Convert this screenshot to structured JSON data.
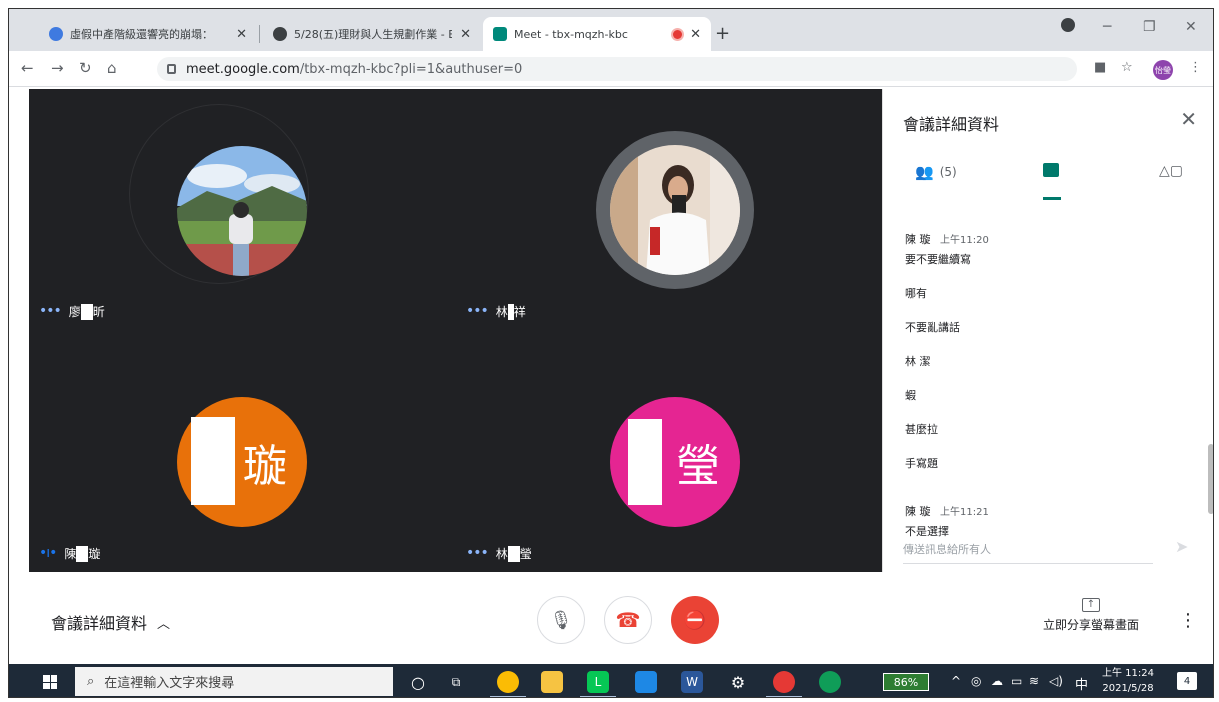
{
  "browser": {
    "tabs": [
      {
        "title": "虛假中產階級還響亮的崩塌：",
        "favicon_color": "#3f7ae0"
      },
      {
        "title": "5/28(五)理財與人生規劃作業 - E",
        "favicon_color": "#3c4043"
      },
      {
        "title": "Meet - tbx-mqzh-kbc",
        "favicon_color": "#00897b"
      }
    ],
    "new_tab": "+",
    "url_host": "meet.google.com",
    "url_rest": "/tbx-mqzh-kbc?pli=1&authuser=0",
    "profile_label": "怡瑩"
  },
  "meet": {
    "tiles": [
      {
        "name_prefix": "廖",
        "name_suffix": "昕",
        "type": "photo"
      },
      {
        "name_prefix": "林",
        "name_suffix": "祥",
        "type": "photo"
      },
      {
        "name_prefix": "陳",
        "name_suffix": "璇",
        "type": "letter",
        "letter": "璇",
        "color": "#e8710a"
      },
      {
        "name_prefix": "林",
        "name_suffix": "瑩",
        "type": "letter",
        "letter": "瑩",
        "color": "#e52592"
      }
    ],
    "panel": {
      "title": "會議詳細資料",
      "people_count": "(5)",
      "messages": [
        {
          "sender": "陳 璇",
          "time": "上午11:20",
          "text": "要不要繼續寫"
        },
        {
          "text": "哪有"
        },
        {
          "text": "不要亂講話"
        },
        {
          "text": "林 潔"
        },
        {
          "text": "蝦"
        },
        {
          "text": "甚麼拉"
        },
        {
          "text": "手寫題"
        },
        {
          "sender": "陳 璇",
          "time": "上午11:21",
          "text": "不是選擇"
        }
      ],
      "compose_placeholder": "傳送訊息給所有人"
    },
    "controls": {
      "meeting_details": "會議詳細資料",
      "present_label": "立即分享螢幕畫面"
    }
  },
  "taskbar": {
    "search_placeholder": "在這裡輸入文字來搜尋",
    "battery": "86%",
    "ime": "中",
    "time": "上午 11:24",
    "date": "2021/5/28",
    "notifications": "4"
  }
}
